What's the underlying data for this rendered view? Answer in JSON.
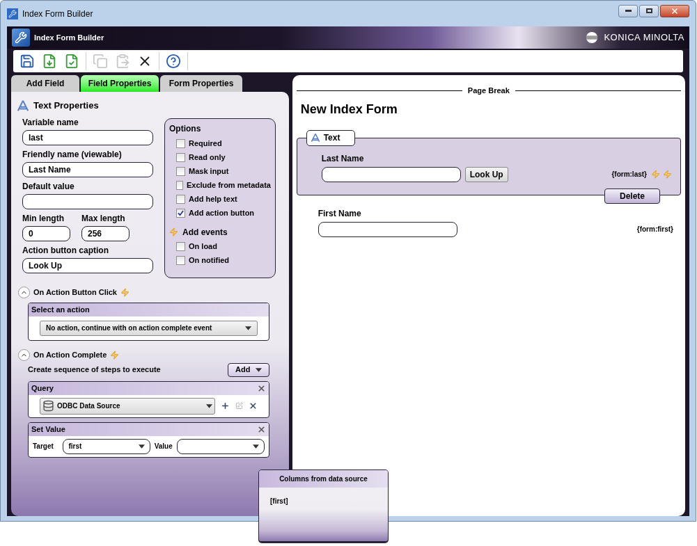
{
  "window": {
    "title": "Index Form Builder"
  },
  "header": {
    "title": "Index Form Builder",
    "brand": "KONICA MINOLTA"
  },
  "toolbar": [
    {
      "kind": "save",
      "disabled": false
    },
    {
      "kind": "import",
      "disabled": false
    },
    {
      "kind": "validate",
      "disabled": false
    },
    {
      "kind": "copy",
      "disabled": true
    },
    {
      "kind": "paste",
      "disabled": true
    },
    {
      "kind": "delete",
      "disabled": false
    },
    {
      "kind": "help",
      "disabled": false
    }
  ],
  "tabs": [
    {
      "label": "Add Field",
      "selected": false
    },
    {
      "label": "Field Properties",
      "selected": true
    },
    {
      "label": "Form Properties",
      "selected": false
    }
  ],
  "properties": {
    "title": "Text Properties",
    "variable_name": {
      "label": "Variable name",
      "value": "last"
    },
    "friendly_name": {
      "label": "Friendly name (viewable)",
      "value": "Last Name"
    },
    "default_value": {
      "label": "Default value"
    },
    "min_length": {
      "label": "Min length",
      "value": "0"
    },
    "max_length": {
      "label": "Max length",
      "value": "256"
    },
    "action_caption": {
      "label": "Action button caption",
      "value": "Look Up"
    },
    "options": {
      "title": "Options",
      "items": [
        {
          "label": "Required",
          "checked": false
        },
        {
          "label": "Read only",
          "checked": false
        },
        {
          "label": "Mask input",
          "checked": false
        },
        {
          "label": "Exclude from metadata",
          "checked": false
        },
        {
          "label": "Add help text",
          "checked": false
        },
        {
          "label": "Add action button",
          "checked": true
        }
      ]
    },
    "events": {
      "title": "Add events",
      "items": [
        {
          "label": "On load",
          "checked": false
        },
        {
          "label": "On notified",
          "checked": false
        }
      ]
    },
    "on_click": {
      "title": "On Action Button Click",
      "expanded": true,
      "box_title": "Select an action",
      "action": "No action, continue with on action complete event"
    },
    "on_complete": {
      "title": "On Action Complete",
      "expanded": true,
      "hint": "Create sequence of steps to execute",
      "add_button": "Add",
      "steps": [
        {
          "kind": "query",
          "title": "Query",
          "source": "ODBC Data Source"
        },
        {
          "kind": "set_value",
          "title": "Set Value",
          "target_label": "Target",
          "target": "first",
          "value_label": "Value"
        }
      ]
    }
  },
  "form": {
    "page_break": "Page Break",
    "title": "New Index Form",
    "fields": [
      {
        "label": "Last Name",
        "selected": true,
        "tag": "Text",
        "button": "Look Up",
        "token": "{form:last}",
        "delete": "Delete"
      },
      {
        "label": "First Name",
        "selected": false,
        "token": "{form:first}"
      }
    ]
  },
  "popup": {
    "title": "Columns from data source",
    "items": [
      "[first]"
    ]
  }
}
